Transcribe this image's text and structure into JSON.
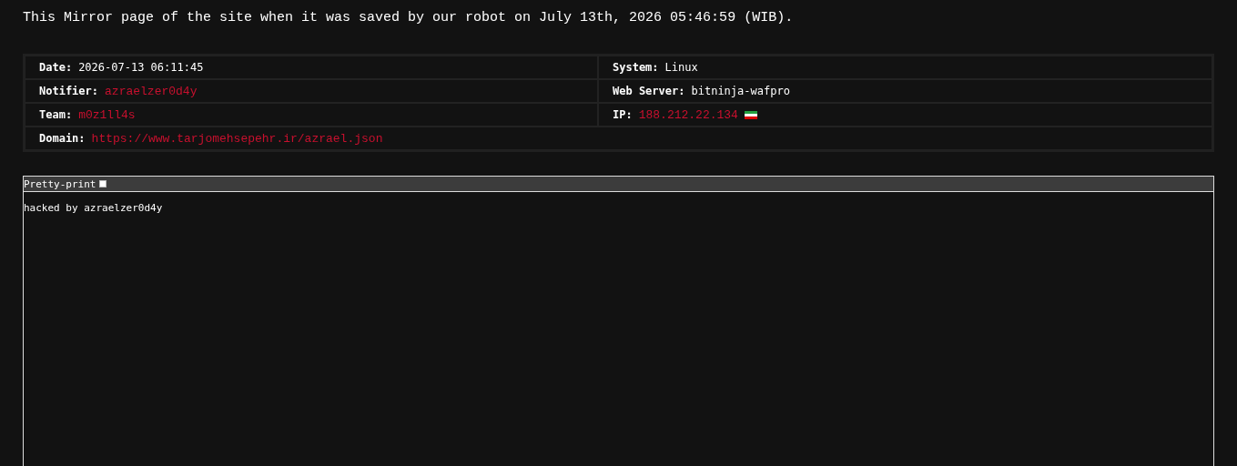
{
  "notice": "This Mirror page of the site when it was saved by our robot on July 13th, 2026 05:46:59 (WIB).",
  "details": [
    [
      {
        "label": "Date:",
        "value": "2026-07-13 06:11:45",
        "kind": "text"
      },
      {
        "label": "System:",
        "value": "Linux",
        "kind": "text"
      }
    ],
    [
      {
        "label": "Notifier:",
        "value": "azraelzer0d4y",
        "kind": "link"
      },
      {
        "label": "Web Server:",
        "value": "bitninja-wafpro",
        "kind": "text"
      }
    ],
    [
      {
        "label": "Team:",
        "value": "m0z1ll4s",
        "kind": "link"
      },
      {
        "label": "IP:",
        "value": "188.212.22.134",
        "kind": "address"
      }
    ],
    [
      {
        "label": "Domain:",
        "value": "https://www.tarjomehsepehr.ir/azrael.json",
        "kind": "link"
      }
    ]
  ],
  "viewer": {
    "pretty_print": {
      "label": "Pretty-print",
      "checked": false
    },
    "content": "hacked by azraelzer0d4y"
  }
}
